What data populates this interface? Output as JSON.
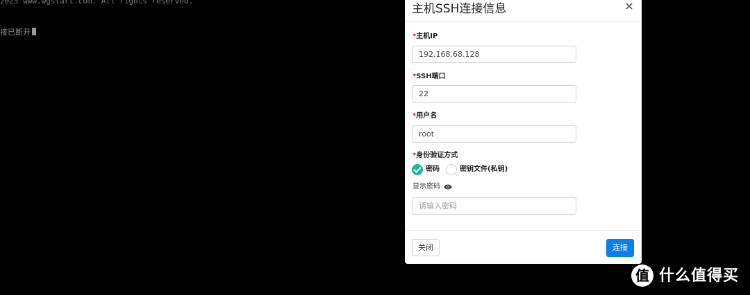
{
  "terminal": {
    "line1": "2023 www.wgstart.com. All rights reserved.",
    "line2": "接已断开"
  },
  "modal": {
    "title": "主机SSH连接信息",
    "close_symbol": "×",
    "required_mark": "*",
    "fields": {
      "host_ip": {
        "label": "主机IP",
        "value": "192.168.68.128"
      },
      "ssh_port": {
        "label": "SSH端口",
        "value": "22"
      },
      "username": {
        "label": "用户名",
        "value": "root"
      },
      "auth_method": {
        "label": "身份验证方式",
        "options": [
          {
            "label": "密码",
            "checked": true
          },
          {
            "label": "密钥文件(私钥)",
            "checked": false
          }
        ]
      },
      "password": {
        "show_label": "显示密码",
        "placeholder": "请输入密码",
        "value": ""
      }
    },
    "footer": {
      "close_label": "关闭",
      "connect_label": "连接"
    }
  },
  "watermark": {
    "badge": "值",
    "text": "什么值得买"
  },
  "colors": {
    "primary": "#0d7de8",
    "radio_checked": "#1fb896",
    "required": "#e0213a"
  }
}
